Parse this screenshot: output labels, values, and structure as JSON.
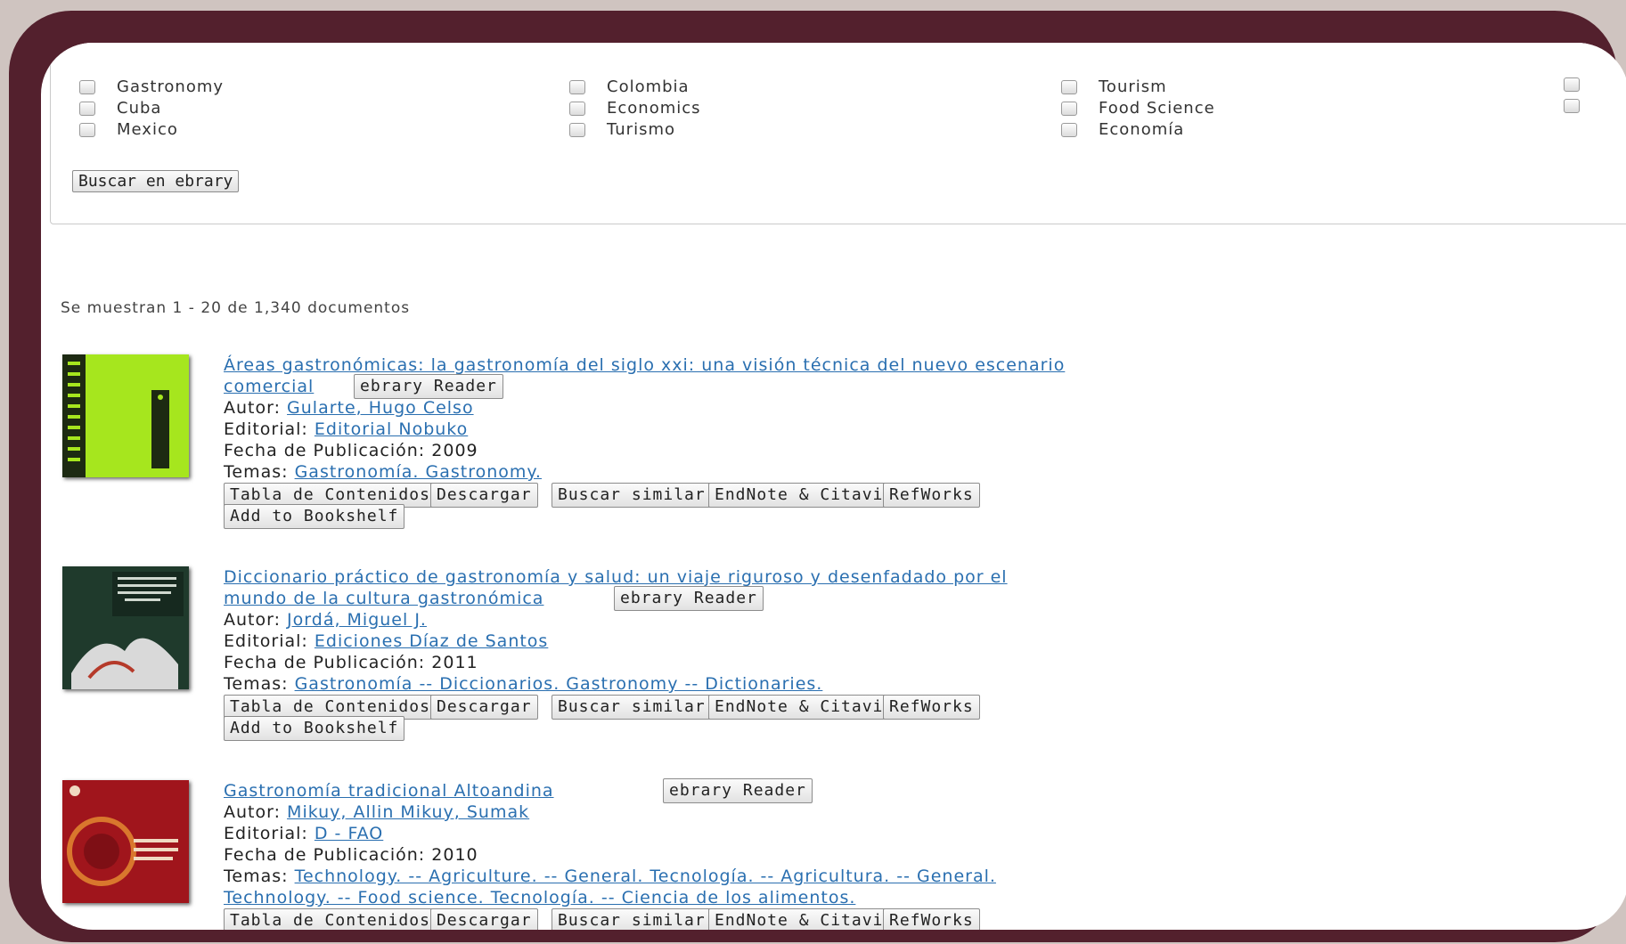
{
  "filters": {
    "col1": [
      "Gastronomy",
      "Cuba",
      "Mexico"
    ],
    "col2": [
      "Colombia",
      "Economics",
      "Turismo"
    ],
    "col3": [
      "Tourism",
      "Food Science",
      "Economía"
    ],
    "search_button": "Buscar en ebrary"
  },
  "results_count": "Se muestran 1 - 20 de 1,340 documentos",
  "labels": {
    "autor": "Autor:",
    "editorial": "Editorial:",
    "fecha": "Fecha de Publicación:",
    "temas": "Temas:"
  },
  "actions": {
    "reader": "ebrary Reader",
    "toc": "Tabla de Contenidos",
    "download": "Descargar",
    "similar": "Buscar similar",
    "endnote": "EndNote & Citavi",
    "refworks": "RefWorks",
    "bookshelf": "Add to Bookshelf"
  },
  "results": [
    {
      "title_l1": "Áreas gastronómicas: la gastronomía del siglo xxi: una visión técnica del nuevo escenario",
      "title_l2": "comercial",
      "author": "Gularte, Hugo Celso",
      "publisher": "Editorial Nobuko",
      "date": "2009",
      "topics_l1": "Gastronomía.   Gastronomy.",
      "thumb_color": "#a6e61e"
    },
    {
      "title_l1": "Diccionario práctico de gastronomía y salud: un viaje riguroso y desenfadado por el",
      "title_l2": "mundo de la cultura gastronómica",
      "author": "Jordá, Miguel J.",
      "publisher": "Ediciones Díaz de Santos",
      "date": "2011",
      "topics_l1": "Gastronomía -- Diccionarios.   Gastronomy -- Dictionaries.",
      "thumb_color": "#1f3a2c"
    },
    {
      "title_l1": "Gastronomía tradicional Altoandina",
      "author": "Mikuy, Allin   Mikuy, Sumak",
      "publisher": "D - FAO",
      "date": "2010",
      "topics_l1": "Technology. -- Agriculture. -- General.   Tecnología. -- Agricultura. -- General.",
      "topics_l2": "Technology. -- Food science.   Tecnología. -- Ciencia de los alimentos.",
      "thumb_color": "#a0151c"
    }
  ]
}
